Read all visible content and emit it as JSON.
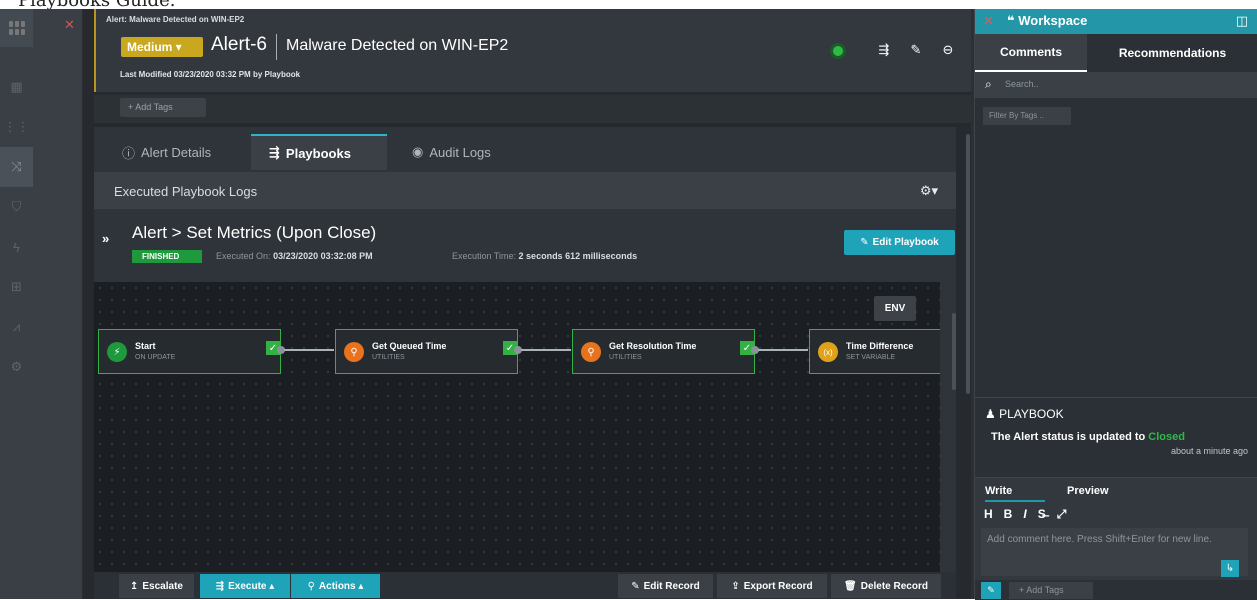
{
  "caption": "Playbooks Guide.",
  "header": {
    "breadcrumb": "Alert: Malware Detected on WIN-EP2",
    "severity": "Medium ▾",
    "alert_id": "Alert-6",
    "alert_title": "Malware Detected on WIN-EP2",
    "modified": "Last Modified 03/23/2020 03:32 PM by Playbook",
    "status_color": "#2dbb47"
  },
  "tags": {
    "add_label": "+ Add Tags"
  },
  "tabs": [
    {
      "icon": "ⓘ",
      "label": "Alert Details"
    },
    {
      "icon": "⇶",
      "label": "Playbooks"
    },
    {
      "icon": "◉",
      "label": "Audit Logs"
    }
  ],
  "section": {
    "title": "Executed Playbook Logs"
  },
  "playbook": {
    "title": "Alert > Set Metrics (Upon Close)",
    "status": "FINISHED",
    "executed_on_label": "Executed On:",
    "executed_on": "03/23/2020 03:32:08 PM",
    "exec_time_label": "Execution Time:",
    "exec_time": "2 seconds 612 milliseconds",
    "edit_label": "Edit Playbook"
  },
  "canvas": {
    "env_label": "ENV",
    "nodes": [
      {
        "title": "Start",
        "subtitle": "ON UPDATE",
        "icon_color": "#1e9a3d",
        "icon": "⚡"
      },
      {
        "title": "Get Queued Time",
        "subtitle": "UTILITIES",
        "icon_color": "#e8731c",
        "icon": "⚲"
      },
      {
        "title": "Get Resolution Time",
        "subtitle": "UTILITIES",
        "icon_color": "#e8731c",
        "icon": "⚲"
      },
      {
        "title": "Time Difference",
        "subtitle": "SET VARIABLE",
        "icon_color": "#e0a21a",
        "icon": "(x)"
      }
    ]
  },
  "bottom": {
    "escalate": "Escalate",
    "execute": "Execute ▴",
    "actions": "Actions ▴",
    "edit_record": "Edit Record",
    "export_record": "Export Record",
    "delete_record": "Delete Record"
  },
  "workspace": {
    "title": "Workspace",
    "tabs": [
      "Comments",
      "Recommendations"
    ],
    "search_placeholder": "Search..",
    "filter_placeholder": "Filter By Tags ..",
    "note": {
      "author": "PLAYBOOK",
      "message_prefix": "The Alert status is updated to",
      "message_status": "Closed",
      "time": "about a minute ago"
    },
    "composer": {
      "tabs": [
        "Write",
        "Preview"
      ],
      "placeholder": "Add comment here. Press Shift+Enter for new line.",
      "add_tags": "+ Add Tags"
    }
  },
  "colors": {
    "accent": "#1fa3b8",
    "severity": "#c9a71e",
    "success": "#33b144"
  }
}
